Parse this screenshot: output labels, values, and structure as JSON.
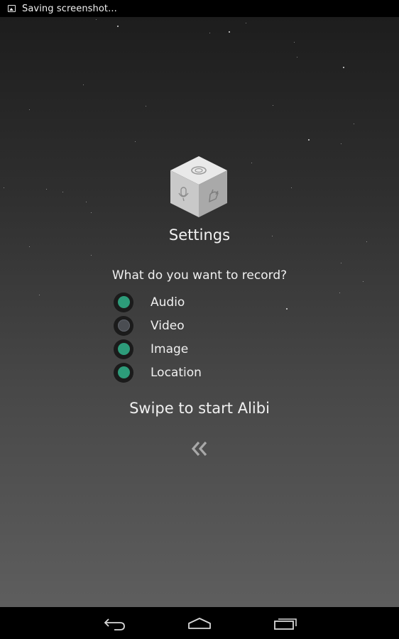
{
  "status_bar": {
    "icon": "image-icon",
    "text": "Saving screenshot..."
  },
  "main": {
    "logo_icon": "settings-cube-icon",
    "title": "Settings",
    "question": "What do you want to record?",
    "options": [
      {
        "label": "Audio",
        "enabled": true
      },
      {
        "label": "Video",
        "enabled": false
      },
      {
        "label": "Image",
        "enabled": true
      },
      {
        "label": "Location",
        "enabled": true
      }
    ],
    "swipe_text": "Swipe to start Alibi",
    "swipe_icon": "double-chevron-left-icon"
  },
  "nav_bar": {
    "buttons": [
      "back-icon",
      "home-icon",
      "recent-apps-icon"
    ]
  },
  "colors": {
    "toggle_on": "#2d9c7a",
    "toggle_off": "#4a4d52",
    "background_top": "#1d1d1d",
    "background_bottom": "#5e5e5e"
  }
}
